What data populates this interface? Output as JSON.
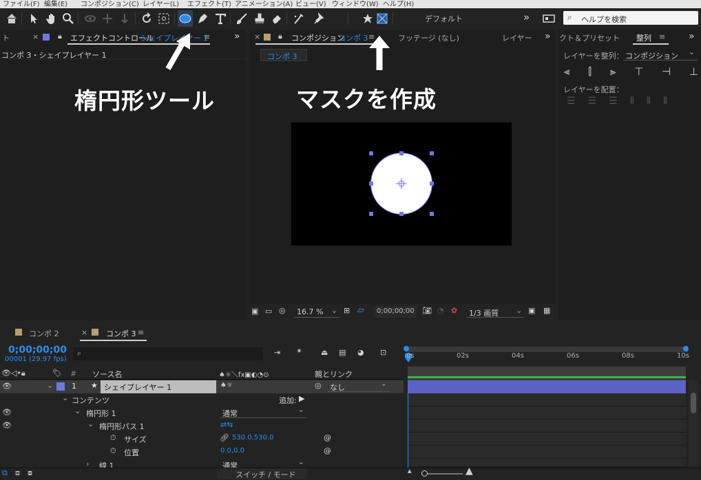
{
  "menu": [
    "ファイル(F)",
    "編集(E)",
    "コンポジション(C)",
    "レイヤー(L)",
    "エフェクト(T)",
    "アニメーション(A)",
    "ビュー(V)",
    "ウィンドウ(W)",
    "ヘルプ(H)"
  ],
  "toolbar": {
    "workspace": "デフォルト",
    "help_placeholder": "ヘルプを検索",
    "more": "»"
  },
  "effects_panel": {
    "close": "×",
    "tab_title": "エフェクトコントロール",
    "tab_layer": "シェイプレイヤー 1",
    "menu": "≡",
    "breadcrumb": "コンポ 3・シェイプレイヤー 1",
    "left_stub": "ト",
    "more": "»"
  },
  "comp_panel": {
    "close": "×",
    "tab_title": "コンポジション",
    "tab_comp": "コンポ 3",
    "menu": "≡",
    "footage_tab": "フッテージ (なし)",
    "layer_tab": "レイヤー",
    "more": "»",
    "comp_chip": "コンポ 3",
    "footer": {
      "zoom": "16.7 %",
      "timecode": "0;00;00;00",
      "resolution": "1/3 画質"
    }
  },
  "right_panel": {
    "effects_tab": "クト＆プリセット",
    "align_tab": "整列",
    "menu": "≡",
    "more": "»",
    "align_to_label": "レイヤーを整列：",
    "align_to_value": "コンポジション",
    "distribute_label": "レイヤーを配置："
  },
  "annotations": {
    "ellipse_tool": "楕円形ツール",
    "create_mask": "マスクを作成"
  },
  "timeline": {
    "tabs": [
      {
        "label": "コンポ 2"
      },
      {
        "label": "コンポ 3"
      }
    ],
    "close": "×",
    "menu": "≡",
    "timecode": "0;00;00;00",
    "frames": "00001 (29.97 fps)",
    "search_placeholder": "",
    "header": {
      "num": "#",
      "source": "ソース名",
      "parent": "親とリンク",
      "switch_icons": "♠☼＼fx▣◐◔⊙"
    },
    "ticks": [
      "0s",
      "02s",
      "04s",
      "06s",
      "08s",
      "10s"
    ],
    "layer": {
      "num": "1",
      "name": "シェイプレイヤー 1",
      "parent": "なし",
      "switch": "♠☼"
    },
    "contents_label": "コンテンツ",
    "add_label": "追加:",
    "ellipse_group": "楕円形 1",
    "ellipse_group_mode": "通常",
    "ellipse_path": "楕円形パス 1",
    "size_label": "サイズ",
    "size_value": "530.0,530.0",
    "position_label": "位置",
    "position_value": "0.0,0.0",
    "stroke_label": "線 1",
    "stroke_mode": "通常",
    "footer_label": "スイッチ / モード"
  },
  "colors": {
    "accent": "#2d8ceb",
    "shape_blue": "#6f79dc",
    "label_tan": "#b59f74"
  }
}
